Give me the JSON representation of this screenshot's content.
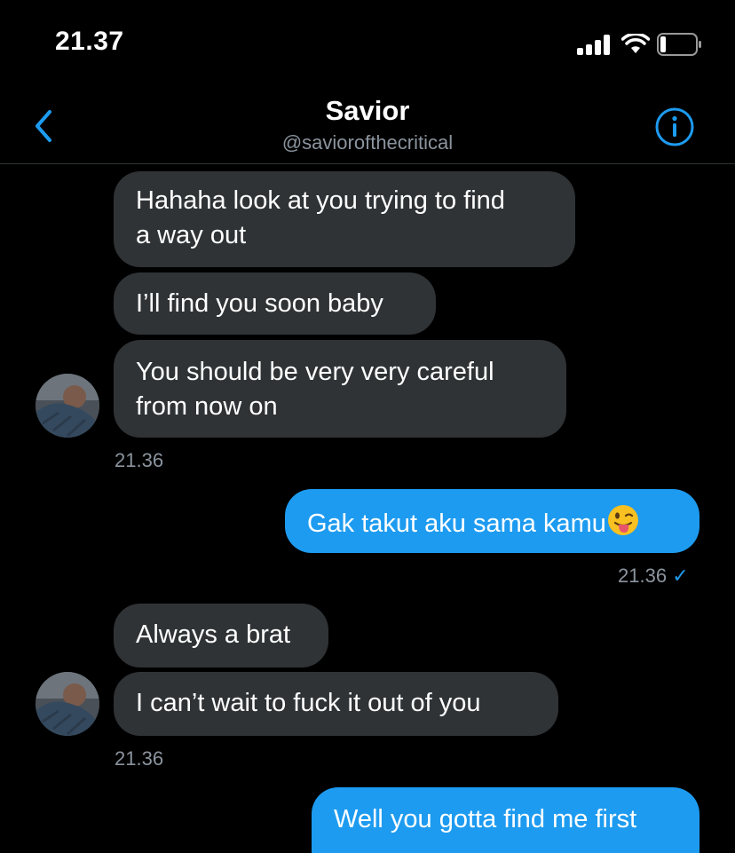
{
  "status_bar": {
    "time": "21.37",
    "icons": [
      "signal-icon",
      "wifi-icon",
      "battery-icon"
    ]
  },
  "header": {
    "title": "Savior",
    "handle": "@saviorofthecritical",
    "back_icon": "chevron-left-icon",
    "info_icon": "info-icon",
    "accent_color": "#1d9bf0"
  },
  "messages": [
    {
      "direction": "in",
      "text": "Hahaha look at you trying to find",
      "text2": "a way out"
    },
    {
      "direction": "in",
      "text": "I’ll find you soon baby"
    },
    {
      "direction": "in",
      "text": "You should be very very careful",
      "text2": "from now on"
    },
    {
      "direction": "in",
      "timestamp": "21.36"
    },
    {
      "direction": "out",
      "text": "Gak takut aku sama kamu",
      "emoji": "face-with-tongue-winking-icon"
    },
    {
      "direction": "out",
      "timestamp": "21.36",
      "status": "✓"
    },
    {
      "direction": "in",
      "text": "Always a brat"
    },
    {
      "direction": "in",
      "text": "I can’t wait to fuck it out of you"
    },
    {
      "direction": "in",
      "timestamp": "21.36"
    },
    {
      "direction": "out",
      "text": "Well you gotta find me first"
    }
  ],
  "colors": {
    "incoming_bubble": "#2f3336",
    "outgoing_bubble": "#1d9bf0",
    "background": "#000000"
  }
}
